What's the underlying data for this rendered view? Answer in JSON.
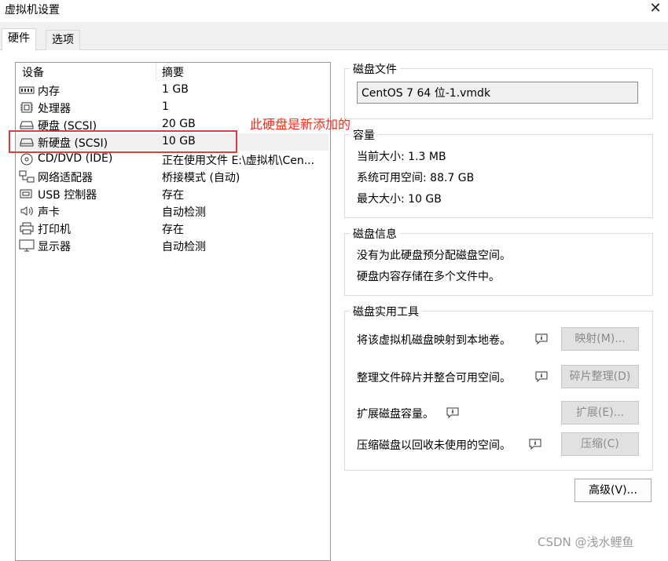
{
  "window": {
    "title": "虚拟机设置",
    "close_glyph": "✕"
  },
  "tabs": [
    {
      "label": "硬件",
      "active": true
    },
    {
      "label": "选项",
      "active": false
    }
  ],
  "device_list": {
    "columns": [
      "设备",
      "摘要"
    ],
    "rows": [
      {
        "name": "内存",
        "summary": "1 GB",
        "icon": "memory-icon"
      },
      {
        "name": "处理器",
        "summary": "1",
        "icon": "processor-icon"
      },
      {
        "name": "硬盘 (SCSI)",
        "summary": "20 GB",
        "icon": "hard-disk-icon"
      },
      {
        "name": "新硬盘 (SCSI)",
        "summary": "10 GB",
        "icon": "hard-disk-icon",
        "selected": true
      },
      {
        "name": "CD/DVD (IDE)",
        "summary": "正在使用文件 E:\\虚拟机\\Cen...",
        "icon": "cd-dvd-icon"
      },
      {
        "name": "网络适配器",
        "summary": "桥接模式 (自动)",
        "icon": "network-adapter-icon"
      },
      {
        "name": "USB 控制器",
        "summary": "存在",
        "icon": "usb-icon"
      },
      {
        "name": "声卡",
        "summary": "自动检测",
        "icon": "sound-card-icon"
      },
      {
        "name": "打印机",
        "summary": "存在",
        "icon": "printer-icon"
      },
      {
        "name": "显示器",
        "summary": "自动检测",
        "icon": "display-icon"
      }
    ]
  },
  "annotation": {
    "text": "此硬盘是新添加的",
    "color": "#ff2a1a"
  },
  "disk_file": {
    "title": "磁盘文件",
    "value": "CentOS 7 64 位-1.vmdk"
  },
  "capacity": {
    "title": "容量",
    "current_size": "当前大小: 1.3 MB",
    "system_free": "系统可用空间: 88.7 GB",
    "max_size": "最大大小: 10 GB"
  },
  "disk_info": {
    "title": "磁盘信息",
    "line1": "没有为此硬盘预分配磁盘空间。",
    "line2": "硬盘内容存储在多个文件中。"
  },
  "disk_utilities": {
    "title": "磁盘实用工具",
    "items": [
      {
        "text": "将该虚拟机磁盘映射到本地卷。",
        "button": "映射(M)..."
      },
      {
        "text": "整理文件碎片并整合可用空间。",
        "button": "碎片整理(D)"
      },
      {
        "text": "扩展磁盘容量。",
        "button": "扩展(E)..."
      },
      {
        "text": "压缩磁盘以回收未使用的空间。",
        "button": "压缩(C)"
      }
    ]
  },
  "advanced_button": "高级(V)...",
  "watermark": "CSDN @浅水鲤鱼"
}
